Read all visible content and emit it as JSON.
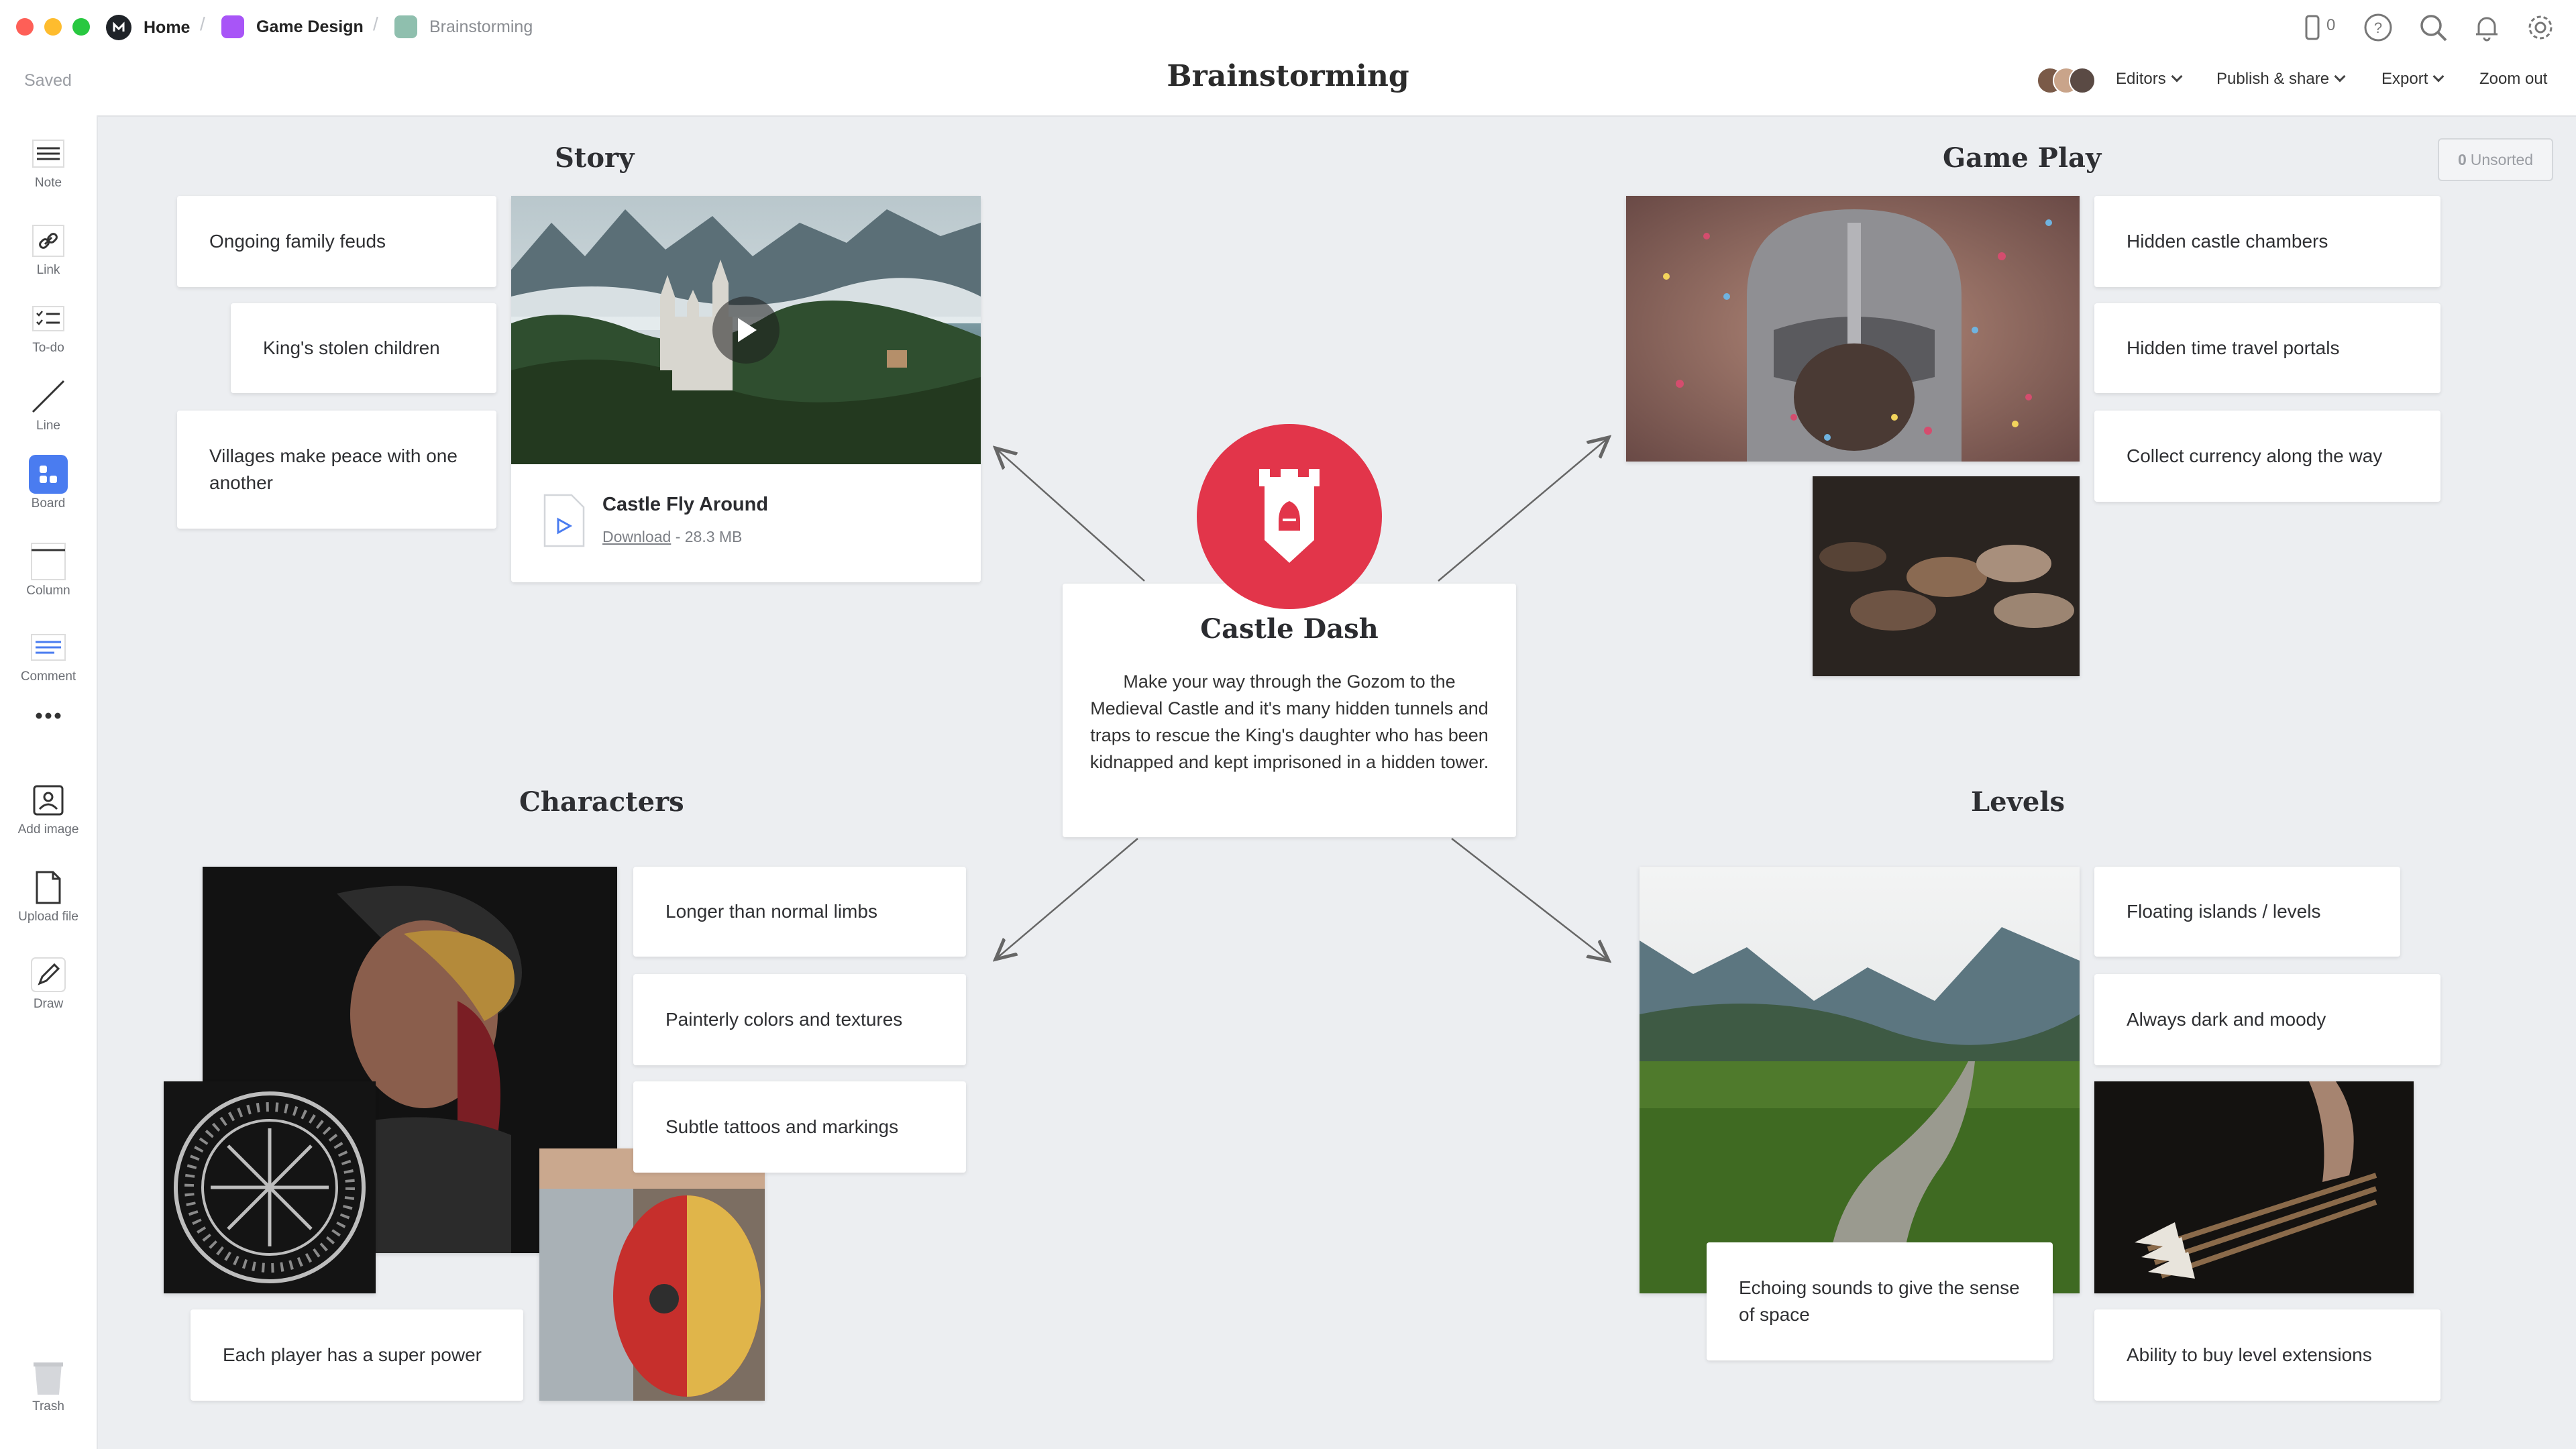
{
  "window": {
    "breadcrumbs": [
      "Home",
      "Game Design",
      "Brainstorming"
    ],
    "status": "Saved",
    "title": "Brainstorming",
    "notifications_count": "0",
    "menu": {
      "editors": "Editors",
      "publish": "Publish & share",
      "export": "Export",
      "zoom": "Zoom out"
    },
    "unsorted_count": "0",
    "unsorted_label": "Unsorted"
  },
  "toolbar": {
    "note": "Note",
    "link": "Link",
    "todo": "To-do",
    "line": "Line",
    "board": "Board",
    "column": "Column",
    "comment": "Comment",
    "add_image": "Add image",
    "upload_file": "Upload file",
    "draw": "Draw",
    "trash": "Trash"
  },
  "center": {
    "title": "Castle Dash",
    "description": "Make your way through the Gozom to the Medieval Castle and it's many hidden tunnels and traps to rescue the King's daughter who has been kidnapped and kept imprisoned in a hidden tower."
  },
  "sections": {
    "story": {
      "heading": "Story",
      "notes": [
        "Ongoing family feuds",
        "King's stolen children",
        "Villages make peace with one another"
      ],
      "video": {
        "title": "Castle Fly Around",
        "download": "Download",
        "size": "- 28.3 MB"
      }
    },
    "gameplay": {
      "heading": "Game Play",
      "notes": [
        "Hidden castle chambers",
        "Hidden time travel portals",
        "Collect currency along the way"
      ]
    },
    "characters": {
      "heading": "Characters",
      "notes": [
        "Longer than normal limbs",
        "Painterly colors and textures",
        "Subtle tattoos and markings",
        "Each player has a super power"
      ]
    },
    "levels": {
      "heading": "Levels",
      "notes": [
        "Floating islands / levels",
        "Always dark and moody",
        "Echoing sounds to give the sense of space",
        "Ability to buy level extensions"
      ]
    }
  },
  "colors": {
    "accent_red": "#e2354a",
    "board_blue": "#4a7cf0",
    "game_design_purple": "#a855f7",
    "brainstorming_teal": "#8fbfae"
  },
  "icons": [
    "logo-icon",
    "mobile-icon",
    "help-icon",
    "search-icon",
    "bell-icon",
    "settings-icon",
    "note-icon",
    "link-icon",
    "todo-icon",
    "line-icon",
    "board-icon",
    "column-icon",
    "comment-icon",
    "more-icon",
    "image-icon",
    "upload-icon",
    "draw-icon",
    "trash-icon",
    "play-icon",
    "castle-icon",
    "video-file-icon"
  ]
}
